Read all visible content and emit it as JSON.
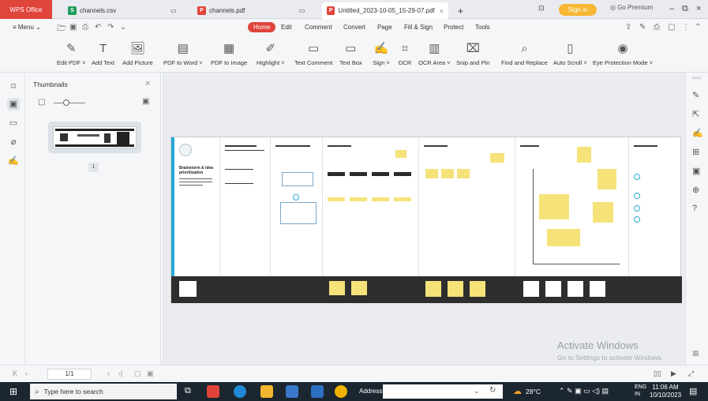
{
  "tabs": [
    {
      "label": "WPS Office"
    },
    {
      "label": "channels.csv",
      "color": "#1e9e5a",
      "glyph": "S"
    },
    {
      "label": "channels.pdf",
      "color": "#e0443b",
      "glyph": "P"
    },
    {
      "label": "Untitled_2023-10-05_15-29-07.pdf",
      "color": "#e0443b",
      "glyph": "P"
    }
  ],
  "account": {
    "sign_in": "Sign in",
    "go_premium": "Go Premium"
  },
  "menu": {
    "menu_label": "Menu",
    "items": [
      "Home",
      "Edit",
      "Comment",
      "Convert",
      "Page",
      "Fill & Sign",
      "Protect",
      "Tools"
    ]
  },
  "ribbon": [
    {
      "label": "Edit PDF",
      "icon": "edit-pdf-icon"
    },
    {
      "label": "Add Text",
      "icon": "add-text-icon"
    },
    {
      "label": "Add Picture",
      "icon": "add-picture-icon"
    },
    {
      "label": "PDF to Word",
      "icon": "pdf-to-word-icon"
    },
    {
      "label": "PDF to Image",
      "icon": "pdf-to-image-icon"
    },
    {
      "label": "Highlight",
      "icon": "highlight-icon"
    },
    {
      "label": "Text Comment",
      "icon": "text-comment-icon"
    },
    {
      "label": "Text Box",
      "icon": "text-box-icon"
    },
    {
      "label": "Sign",
      "icon": "sign-icon"
    },
    {
      "label": "OCR",
      "icon": "ocr-icon"
    },
    {
      "label": "OCR Area",
      "icon": "ocr-area-icon"
    },
    {
      "label": "Snip and Pin",
      "icon": "snip-icon"
    },
    {
      "label": "Find and Replace",
      "icon": "search-icon"
    },
    {
      "label": "Auto Scroll",
      "icon": "auto-scroll-icon"
    },
    {
      "label": "Eye Protection Mode",
      "icon": "eye-icon"
    }
  ],
  "thumbnails": {
    "title": "Thumbnails",
    "page_badge": "1"
  },
  "document": {
    "brainstorm_title": "Brainstorm & idea prioritization"
  },
  "watermark": {
    "line1": "Activate Windows",
    "line2": "Go to Settings to activate Windows."
  },
  "status": {
    "page_indicator": "1/1"
  },
  "taskbar": {
    "search_placeholder": "Type here to search",
    "address_label": "Address",
    "temperature": "28°C",
    "lang1": "ENG",
    "lang2": "IN",
    "time": "11:06 AM",
    "date": "10/10/2023"
  }
}
